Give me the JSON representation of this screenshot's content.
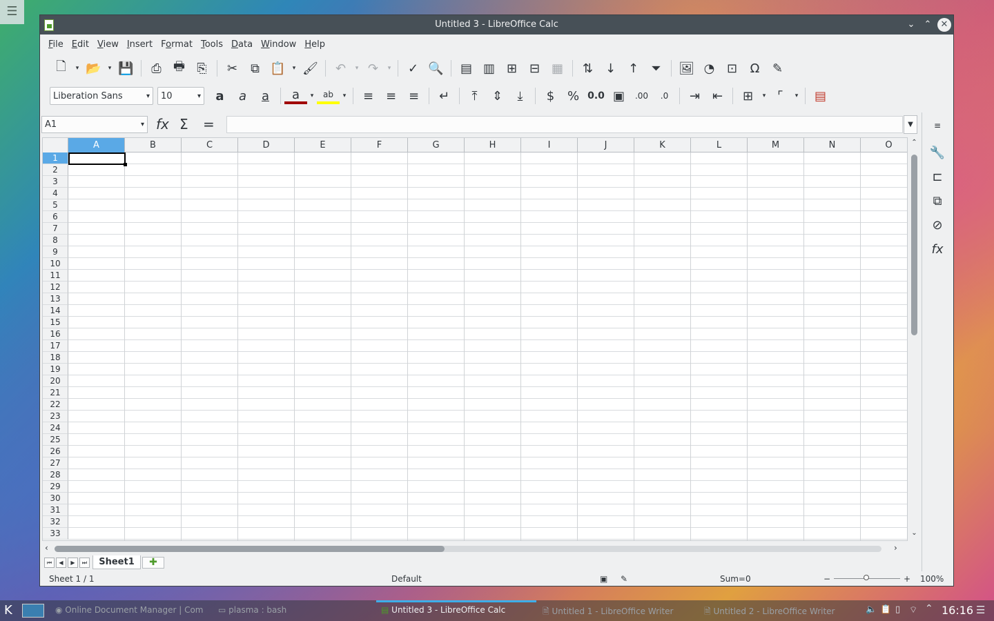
{
  "window": {
    "title": "Untitled 3 - LibreOffice Calc"
  },
  "menu": [
    "File",
    "Edit",
    "View",
    "Insert",
    "Format",
    "Tools",
    "Data",
    "Window",
    "Help"
  ],
  "menu_underline": [
    "F",
    "E",
    "V",
    "I",
    "o",
    "T",
    "D",
    "W",
    "H"
  ],
  "font": {
    "name": "Liberation Sans",
    "size": "10"
  },
  "formula": {
    "cell_ref": "A1",
    "value": ""
  },
  "columns": [
    "A",
    "B",
    "C",
    "D",
    "E",
    "F",
    "G",
    "H",
    "I",
    "J",
    "K",
    "L",
    "M",
    "N",
    "O"
  ],
  "rows": [
    "1",
    "2",
    "3",
    "4",
    "5",
    "6",
    "7",
    "8",
    "9",
    "10",
    "11",
    "12",
    "13",
    "14",
    "15",
    "16",
    "17",
    "18",
    "19",
    "20",
    "21",
    "22",
    "23",
    "24",
    "25",
    "26",
    "27",
    "28",
    "29",
    "30",
    "31",
    "32",
    "33"
  ],
  "selected": {
    "column": "A",
    "row": "1"
  },
  "sheets": {
    "tab": "Sheet1"
  },
  "status": {
    "sheet": "Sheet 1 / 1",
    "style": "Default",
    "sum": "Sum=0",
    "zoom": "100%"
  },
  "taskbar": {
    "items": [
      "Online Document Manager | Com",
      "plasma : bash",
      "Untitled 3 - LibreOffice Calc",
      "Untitled 1 - LibreOffice Writer",
      "Untitled 2 - LibreOffice Writer"
    ],
    "clock": "16:16"
  }
}
